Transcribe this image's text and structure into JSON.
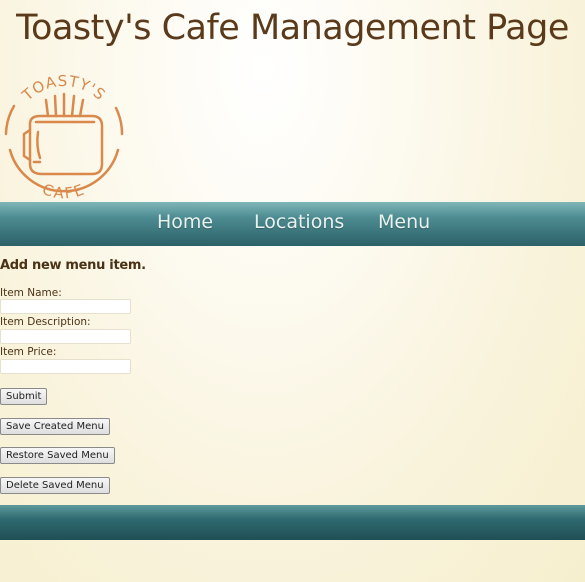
{
  "header": {
    "title": "Toasty's Cafe Management Page"
  },
  "logo": {
    "top_text": "TOASTY'S",
    "bottom_text": "CAFE"
  },
  "nav": {
    "items": [
      {
        "label": "Home"
      },
      {
        "label": "Locations"
      },
      {
        "label": "Menu"
      }
    ]
  },
  "form": {
    "heading": "Add new menu item.",
    "item_name_label": "Item Name:",
    "item_name_value": "",
    "item_description_label": "Item Description:",
    "item_description_value": "",
    "item_price_label": "Item Price:",
    "item_price_value": "",
    "submit_label": "Submit"
  },
  "actions": {
    "save_label": "Save Created Menu",
    "restore_label": "Restore Saved Menu",
    "delete_label": "Delete Saved Menu"
  },
  "colors": {
    "title": "#5a3a1b",
    "logo": "#d9894b",
    "nav_bar": "#4d8c92",
    "background": "#f9f3dc"
  }
}
